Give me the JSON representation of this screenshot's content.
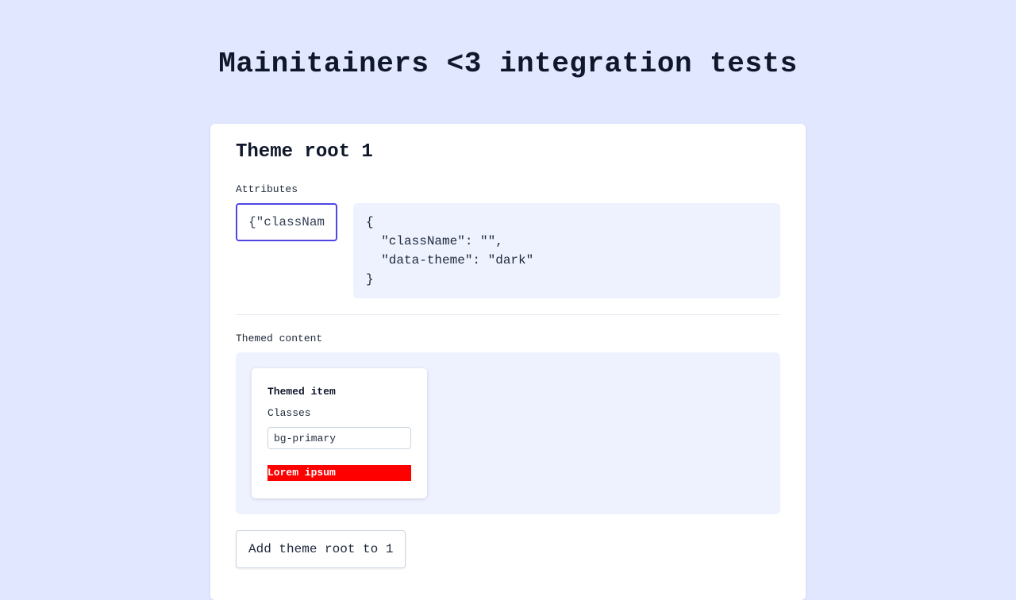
{
  "page": {
    "title": "Mainitainers <3 integration tests"
  },
  "theme_root": {
    "title": "Theme root 1",
    "attributes_label": "Attributes",
    "attributes_input_value": "{\"className\":\"\",\"data-theme\":\"dark\"}",
    "attributes_json": "{\n  \"className\": \"\",\n  \"data-theme\": \"dark\"\n}",
    "themed_content_label": "Themed content",
    "item": {
      "title": "Themed item",
      "classes_label": "Classes",
      "classes_value": "bg-primary",
      "sample_text": "Lorem ipsum",
      "sample_bg_color": "#ff0000"
    },
    "add_button_label": "Add theme root to 1"
  },
  "colors": {
    "page_background": "#e0e7ff",
    "accent": "#4f46e5",
    "panel_background": "#eef2ff"
  }
}
